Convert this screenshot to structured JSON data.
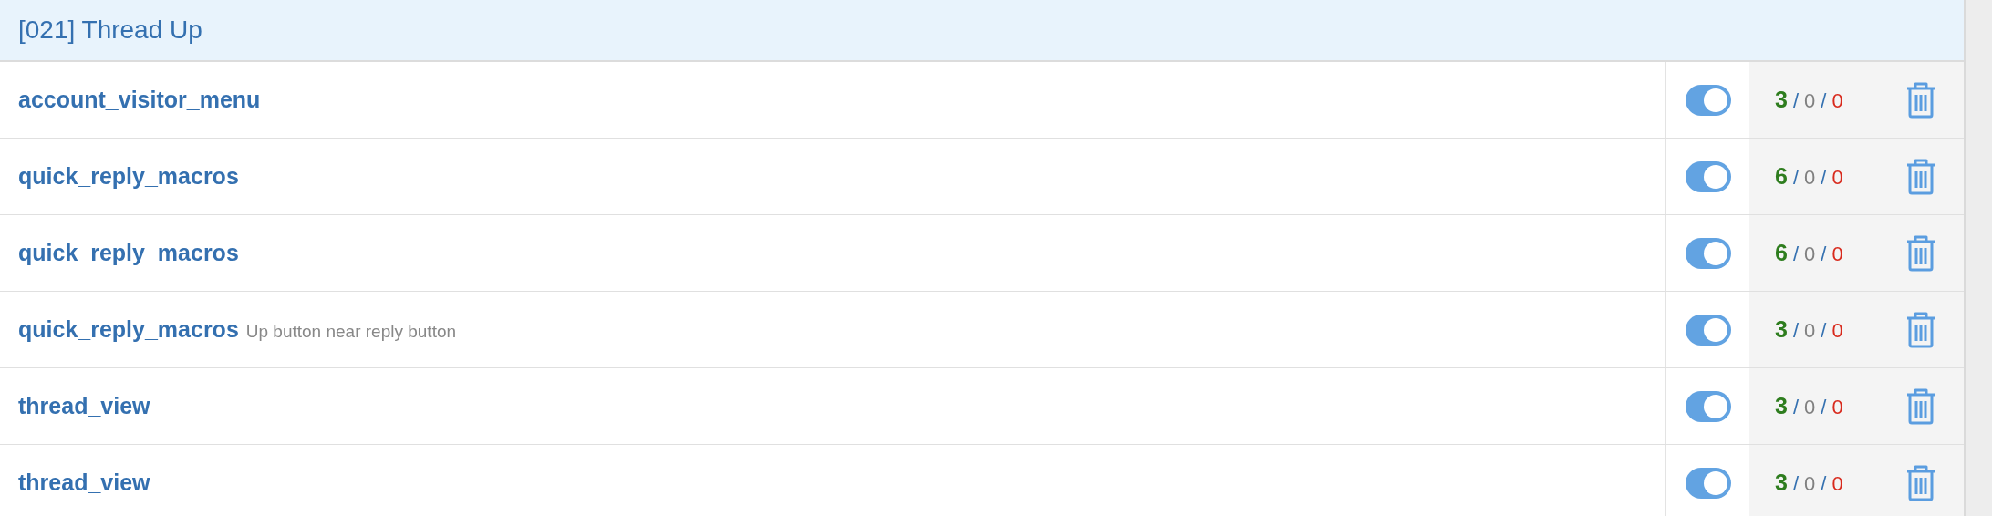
{
  "section": {
    "title": "[021] Thread Up"
  },
  "rows": [
    {
      "name": "account_visitor_menu",
      "enabled": true,
      "passed": "3",
      "separators": [
        "/",
        "/"
      ],
      "skipped": "0",
      "failed": "0"
    },
    {
      "name": "quick_reply_macros",
      "enabled": true,
      "passed": "6",
      "separators": [
        "/",
        "/"
      ],
      "skipped": "0",
      "failed": "0"
    },
    {
      "name": "quick_reply_macros",
      "enabled": true,
      "passed": "6",
      "separators": [
        "/",
        "/"
      ],
      "skipped": "0",
      "failed": "0"
    },
    {
      "name": "quick_reply_macros",
      "note": "Up button near reply button",
      "enabled": true,
      "passed": "3",
      "separators": [
        "/",
        "/"
      ],
      "skipped": "0",
      "failed": "0"
    },
    {
      "name": "thread_view",
      "enabled": true,
      "passed": "3",
      "separators": [
        "/",
        "/"
      ],
      "skipped": "0",
      "failed": "0"
    },
    {
      "name": "thread_view",
      "enabled": true,
      "passed": "3",
      "separators": [
        "/",
        "/"
      ],
      "skipped": "0",
      "failed": "0"
    }
  ]
}
